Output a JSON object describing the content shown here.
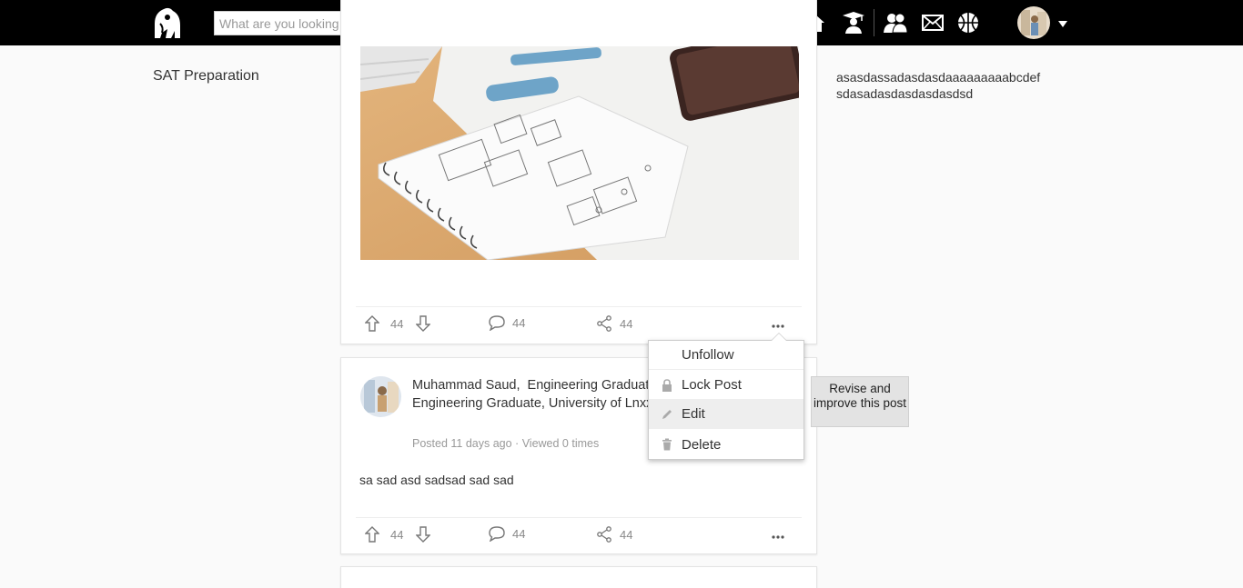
{
  "header": {
    "search_placeholder": "What are you looking for?"
  },
  "left": {
    "link": "SAT Preparation"
  },
  "right": {
    "line1": "asasdassadasdasdaaaaaaaaabcdef",
    "line2": "sdasadasdasdasdasdsd"
  },
  "post1": {
    "upvotes": "44",
    "comments": "44",
    "shares": "44"
  },
  "post2": {
    "author": "Muhammad Saud,",
    "headline": "Engineering Graduate, University of Lnxx, Engineering Graduate, University of Lnxx Technology",
    "posted": "Posted 11 days ago",
    "viewed": "Viewed 0 times",
    "body": "sa sad asd sadsad sad sad",
    "upvotes": "44",
    "comments": "44",
    "shares": "44"
  },
  "dropdown": {
    "items": [
      {
        "label": "Unfollow",
        "icon": "none"
      },
      {
        "label": "Lock Post",
        "icon": "lock-icon"
      },
      {
        "label": "Edit",
        "icon": "pencil-icon"
      },
      {
        "label": "Delete",
        "icon": "trash-icon"
      }
    ]
  },
  "tooltip": {
    "text": "Revise and improve this post"
  }
}
